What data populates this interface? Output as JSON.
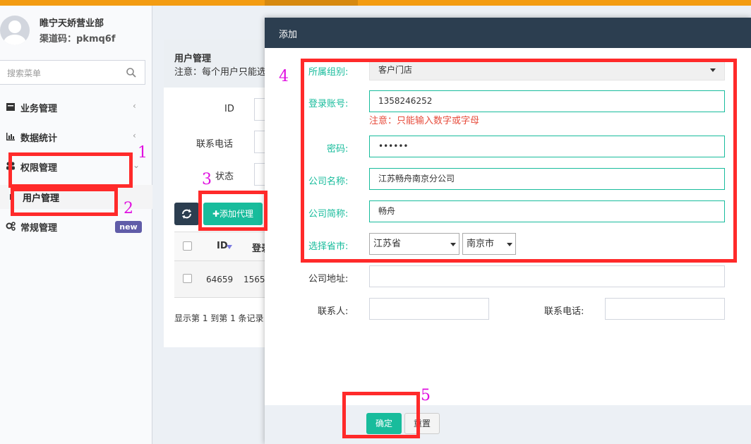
{
  "user": {
    "name": "睢宁天娇营业部",
    "channel": "渠道码：pkmq6f"
  },
  "sidebar": {
    "search_placeholder": "搜索菜单",
    "items": [
      {
        "label": "业务管理",
        "icon": "briefcase-icon"
      },
      {
        "label": "数据统计",
        "icon": "bar-chart-icon"
      },
      {
        "label": "权限管理",
        "icon": "group-icon"
      },
      {
        "label": "用户管理",
        "icon": "user-icon"
      },
      {
        "label": "常规管理",
        "icon": "cogs-icon",
        "badge": "new"
      }
    ],
    "chevron_left": "‹",
    "chevron_down": "⌄"
  },
  "content": {
    "title": "用户管理",
    "note": "注意：每个用户只能选",
    "filter_id": "ID",
    "filter_phone": "联系电话",
    "filter_status": "状态",
    "add_button": "✚添加代理",
    "table": {
      "headers": [
        "ID",
        "登录"
      ],
      "rows": [
        [
          "64659",
          "1565"
        ]
      ]
    },
    "footer": "显示第 1 到第 1 条记录"
  },
  "modal": {
    "title": "添加",
    "group_label": "所属组别:",
    "group_value": "客户门店",
    "account_label": "登录账号:",
    "account_value": "1358246252",
    "account_warning": "注意：只能输入数字或字母",
    "password_label": "密码:",
    "password_value": "••••••",
    "company_label": "公司名称:",
    "company_value": "江苏畅舟南京分公司",
    "short_label": "公司简称:",
    "short_value": "畅舟",
    "region_label": "选择省市:",
    "province": "江苏省",
    "city": "南京市",
    "address_label": "公司地址:",
    "contact_label": "联系人:",
    "phone_label": "联系电话:",
    "ok_button": "确定",
    "reset_button": "重置"
  },
  "annotations": [
    "1",
    "2",
    "3",
    "4",
    "5"
  ],
  "colors": {
    "accent": "#18bc9c",
    "header": "#2c3e50",
    "highlight": "#ff2a2a",
    "annotation": "#e010e0",
    "topbar": "#f39c12"
  }
}
